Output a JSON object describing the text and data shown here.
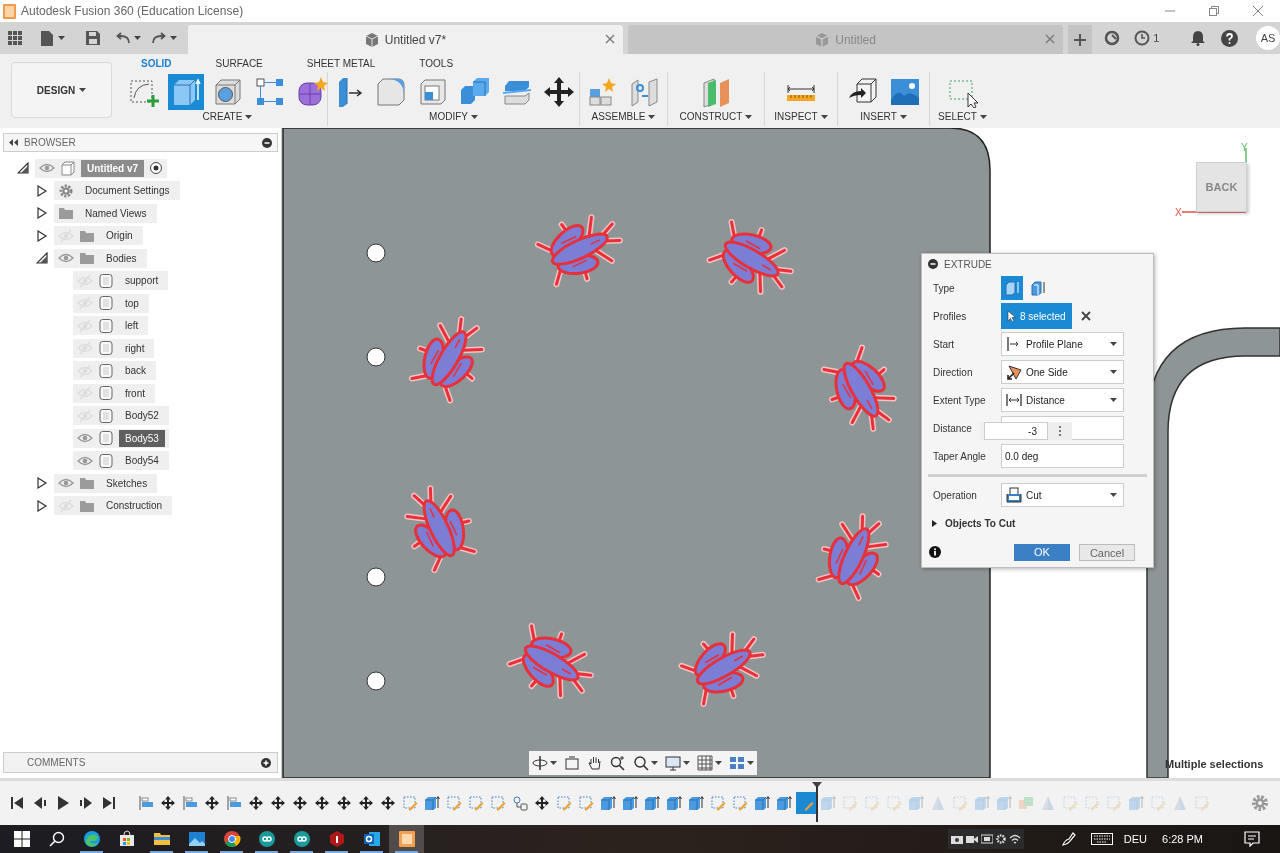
{
  "window": {
    "title": "Autodesk Fusion 360 (Education License)"
  },
  "document_tabs": [
    {
      "title": "Untitled v7*",
      "selected": true
    },
    {
      "title": "Untitled",
      "selected": false
    }
  ],
  "header": {
    "job_count": "1",
    "user_initials": "AS"
  },
  "workspace": {
    "label": "DESIGN"
  },
  "toolbar_tabs": [
    {
      "label": "SOLID",
      "selected": true
    },
    {
      "label": "SURFACE",
      "selected": false
    },
    {
      "label": "SHEET METAL",
      "selected": false
    },
    {
      "label": "TOOLS",
      "selected": false
    }
  ],
  "tool_groups": [
    {
      "label": "CREATE",
      "tools": [
        {
          "kind": "sketch",
          "selected": false
        },
        {
          "kind": "extrude",
          "selected": true
        },
        {
          "kind": "hole",
          "selected": false
        },
        {
          "kind": "pattern",
          "selected": false
        },
        {
          "kind": "form",
          "selected": false
        }
      ]
    },
    {
      "label": "MODIFY",
      "tools": [
        {
          "kind": "press_pull",
          "selected": false
        },
        {
          "kind": "fillet",
          "selected": false
        },
        {
          "kind": "shell",
          "selected": false
        },
        {
          "kind": "combine",
          "selected": false
        },
        {
          "kind": "split",
          "selected": false
        },
        {
          "kind": "move",
          "selected": false
        }
      ]
    },
    {
      "label": "ASSEMBLE",
      "tools": [
        {
          "kind": "new_component",
          "selected": false
        },
        {
          "kind": "joint",
          "selected": false
        }
      ]
    },
    {
      "label": "CONSTRUCT",
      "tools": [
        {
          "kind": "plane",
          "selected": false
        }
      ]
    },
    {
      "label": "INSPECT",
      "tools": [
        {
          "kind": "measure",
          "selected": false
        }
      ]
    },
    {
      "label": "INSERT",
      "tools": [
        {
          "kind": "insert",
          "selected": false
        },
        {
          "kind": "image",
          "selected": false
        }
      ]
    },
    {
      "label": "SELECT",
      "tools": [
        {
          "kind": "select",
          "selected": false
        }
      ]
    }
  ],
  "browser": {
    "title": "BROWSER",
    "tree": [
      {
        "label": "Untitled v7",
        "kind": "component",
        "expanded": true,
        "visible": true,
        "active": true,
        "children": [
          {
            "label": "Document Settings",
            "kind": "settings",
            "expanded": false,
            "selected": false
          },
          {
            "label": "Named Views",
            "kind": "folder",
            "expanded": false,
            "selected": false
          },
          {
            "label": "Origin",
            "kind": "folder",
            "expanded": false,
            "visible": false,
            "selected": false
          },
          {
            "label": "Bodies",
            "kind": "folder",
            "expanded": true,
            "visible": true,
            "selected": false,
            "children": [
              {
                "label": "support",
                "kind": "body",
                "visible": false,
                "selected": false
              },
              {
                "label": "top",
                "kind": "body",
                "visible": false,
                "selected": false
              },
              {
                "label": "left",
                "kind": "body",
                "visible": false,
                "selected": false
              },
              {
                "label": "right",
                "kind": "body",
                "visible": false,
                "selected": false
              },
              {
                "label": "back",
                "kind": "body",
                "visible": false,
                "selected": false
              },
              {
                "label": "front",
                "kind": "body",
                "visible": false,
                "selected": false
              },
              {
                "label": "Body52",
                "kind": "body",
                "visible": false,
                "selected": false
              },
              {
                "label": "Body53",
                "kind": "body",
                "visible": true,
                "selected": true
              },
              {
                "label": "Body54",
                "kind": "body",
                "visible": true,
                "selected": false
              }
            ]
          },
          {
            "label": "Sketches",
            "kind": "folder",
            "expanded": false,
            "visible": true,
            "selected": false
          },
          {
            "label": "Construction",
            "kind": "folder",
            "expanded": false,
            "visible": false,
            "selected": false
          }
        ]
      }
    ]
  },
  "comments": {
    "title": "COMMENTS"
  },
  "extrude_dialog": {
    "title": "EXTRUDE",
    "rows": [
      {
        "kind": "type",
        "label": "Type",
        "options": [
          {
            "kind": "solid",
            "selected": true
          },
          {
            "kind": "thin",
            "selected": false
          }
        ]
      },
      {
        "kind": "selection",
        "label": "Profiles",
        "value": "8 selected"
      },
      {
        "kind": "start",
        "label": "Start",
        "value": "Profile Plane"
      },
      {
        "kind": "direction",
        "label": "Direction",
        "value": "One Side"
      },
      {
        "kind": "extent",
        "label": "Extent Type",
        "value": "Distance"
      },
      {
        "kind": "distance",
        "label": "Distance",
        "value": "-3"
      },
      {
        "kind": "input",
        "label": "Taper Angle",
        "value": "0.0 deg"
      },
      {
        "kind": "divider"
      },
      {
        "kind": "operation",
        "label": "Operation",
        "value": "Cut"
      }
    ],
    "objects_to_cut": {
      "label": "Objects To Cut",
      "expanded": false
    },
    "buttons": [
      {
        "label": "OK",
        "kind": "primary"
      },
      {
        "label": "Cancel",
        "kind": "secondary"
      }
    ]
  },
  "view_cube": {
    "face": "BACK",
    "y_axis": "Y",
    "x_axis": "X"
  },
  "status": "Multiple selections",
  "timeline": [
    {
      "kind": "align",
      "rolled_back": false,
      "selected": false
    },
    {
      "kind": "move",
      "rolled_back": false,
      "selected": false
    },
    {
      "kind": "align",
      "rolled_back": false,
      "selected": false
    },
    {
      "kind": "move",
      "rolled_back": false,
      "selected": false
    },
    {
      "kind": "align",
      "rolled_back": false,
      "selected": false
    },
    {
      "kind": "move",
      "rolled_back": false,
      "selected": false
    },
    {
      "kind": "move",
      "rolled_back": false,
      "selected": false
    },
    {
      "kind": "move",
      "rolled_back": false,
      "selected": false
    },
    {
      "kind": "move",
      "rolled_back": false,
      "selected": false
    },
    {
      "kind": "move",
      "rolled_back": false,
      "selected": false
    },
    {
      "kind": "move",
      "rolled_back": false,
      "selected": false
    },
    {
      "kind": "move",
      "rolled_back": false,
      "selected": false
    },
    {
      "kind": "sketch",
      "rolled_back": false,
      "selected": false
    },
    {
      "kind": "extrude",
      "rolled_back": false,
      "selected": false
    },
    {
      "kind": "sketch",
      "rolled_back": false,
      "selected": false
    },
    {
      "kind": "sketch",
      "rolled_back": false,
      "selected": false
    },
    {
      "kind": "sketch",
      "rolled_back": false,
      "selected": false
    },
    {
      "kind": "joint",
      "rolled_back": false,
      "selected": false
    },
    {
      "kind": "move",
      "rolled_back": false,
      "selected": false
    },
    {
      "kind": "sketch",
      "rolled_back": false,
      "selected": false
    },
    {
      "kind": "sketch",
      "rolled_back": false,
      "selected": false
    },
    {
      "kind": "extrude",
      "rolled_back": false,
      "selected": false
    },
    {
      "kind": "extrude",
      "rolled_back": false,
      "selected": false
    },
    {
      "kind": "extrude",
      "rolled_back": false,
      "selected": false
    },
    {
      "kind": "extrude",
      "rolled_back": false,
      "selected": false
    },
    {
      "kind": "extrude",
      "rolled_back": false,
      "selected": false
    },
    {
      "kind": "sketch",
      "rolled_back": false,
      "selected": false
    },
    {
      "kind": "sketch",
      "rolled_back": false,
      "selected": false
    },
    {
      "kind": "extrude",
      "rolled_back": false,
      "selected": false
    },
    {
      "kind": "extrude",
      "rolled_back": false,
      "selected": false
    },
    {
      "kind": "sketch",
      "rolled_back": false,
      "selected": true
    },
    {
      "kind": "extrude",
      "rolled_back": true,
      "selected": false
    },
    {
      "kind": "sketch",
      "rolled_back": true,
      "selected": false
    },
    {
      "kind": "sketch",
      "rolled_back": true,
      "selected": false
    },
    {
      "kind": "sketch",
      "rolled_back": true,
      "selected": false
    },
    {
      "kind": "extrude",
      "rolled_back": true,
      "selected": false
    },
    {
      "kind": "mirror",
      "rolled_back": true,
      "selected": false
    },
    {
      "kind": "sketch",
      "rolled_back": true,
      "selected": false
    },
    {
      "kind": "extrude",
      "rolled_back": true,
      "selected": false
    },
    {
      "kind": "extrude",
      "rolled_back": true,
      "selected": false
    },
    {
      "kind": "combine",
      "rolled_back": true,
      "selected": false
    },
    {
      "kind": "mirror",
      "rolled_back": true,
      "selected": false
    },
    {
      "kind": "sketch",
      "rolled_back": true,
      "selected": false
    },
    {
      "kind": "sketch",
      "rolled_back": true,
      "selected": false
    },
    {
      "kind": "sketch",
      "rolled_back": true,
      "selected": false
    },
    {
      "kind": "extrude",
      "rolled_back": true,
      "selected": false
    },
    {
      "kind": "sketch",
      "rolled_back": true,
      "selected": false
    },
    {
      "kind": "mirror",
      "rolled_back": true,
      "selected": false
    },
    {
      "kind": "sketch",
      "rolled_back": true,
      "selected": false
    }
  ],
  "taskbar": {
    "apps": [
      {
        "kind": "edge",
        "running": true,
        "selected": false
      },
      {
        "kind": "store",
        "running": false,
        "selected": false
      },
      {
        "kind": "explorer",
        "running": true,
        "selected": false
      },
      {
        "kind": "photos",
        "running": true,
        "selected": false
      },
      {
        "kind": "chrome",
        "running": true,
        "selected": false
      },
      {
        "kind": "arduino",
        "running": true,
        "selected": false
      },
      {
        "kind": "arduino",
        "running": true,
        "selected": false
      },
      {
        "kind": "hexagon",
        "running": true,
        "selected": false
      },
      {
        "kind": "outlook",
        "running": true,
        "selected": false
      },
      {
        "kind": "fusion",
        "running": true,
        "selected": true
      }
    ],
    "language": "DEU",
    "time": "6:28 PM"
  }
}
